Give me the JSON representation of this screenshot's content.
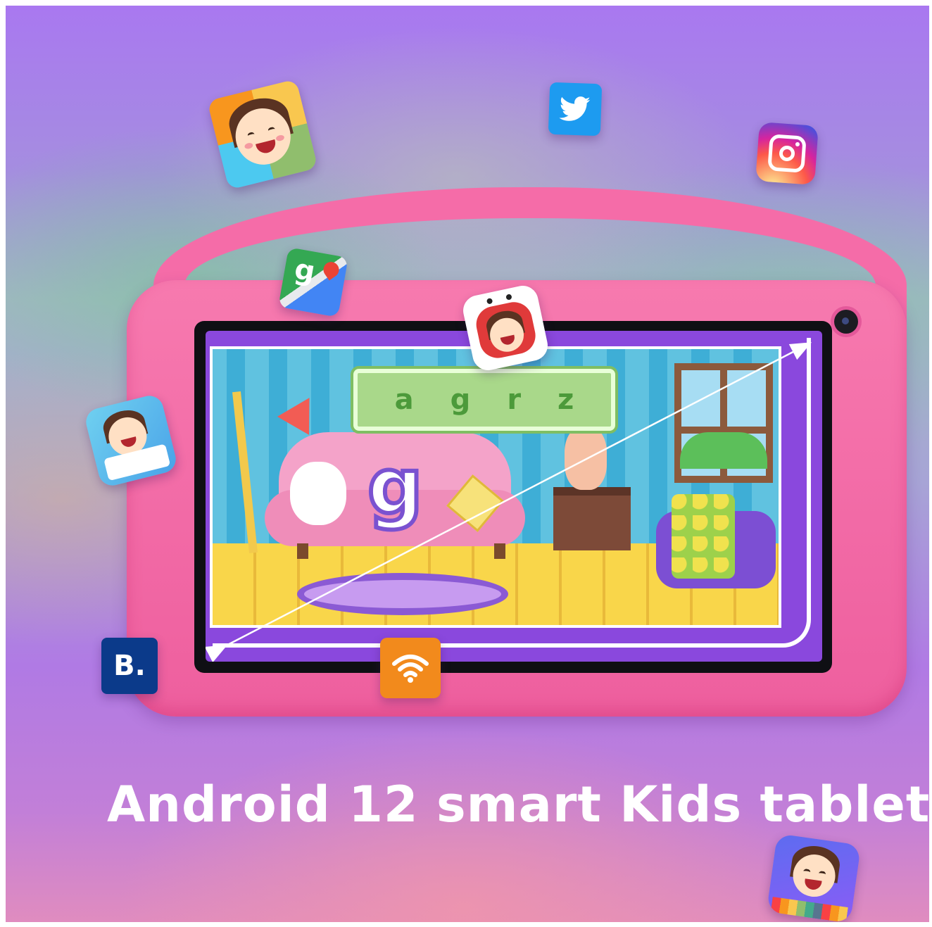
{
  "headline": "Android 12 smart Kids tablet",
  "screen": {
    "word_letters": [
      "a",
      "g",
      "r",
      "z"
    ],
    "big_letter": "g"
  },
  "icons": {
    "booking_letter": "B.",
    "kids_face_app": "kids-face-app-icon",
    "twitter": "twitter-icon",
    "instagram": "instagram-icon",
    "maps": "google-maps-icon",
    "kids_tv": "kids-tv-app-icon",
    "kids_book": "kids-book-app-icon",
    "booking": "booking-icon",
    "wifi": "wifi-icon",
    "kids_drawing": "kids-drawing-app-icon"
  },
  "colors": {
    "case": "#f56ca8",
    "screen_frame": "#8a48dd",
    "twitter": "#1d9bf0",
    "booking": "#0b3a8a",
    "wifi": "#f28a1c"
  }
}
